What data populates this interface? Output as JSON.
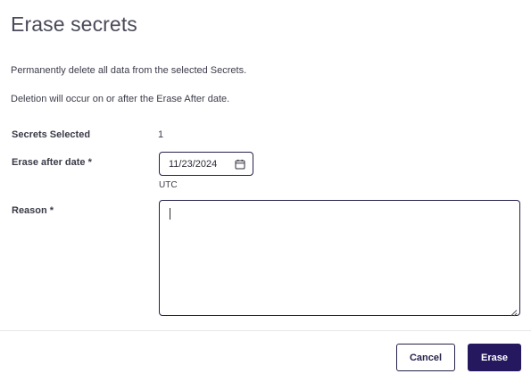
{
  "dialog": {
    "title": "Erase secrets",
    "description_1": "Permanently delete all data from the selected Secrets.",
    "description_2": "Deletion will occur on or after the Erase After date."
  },
  "form": {
    "secrets_selected_label": "Secrets Selected",
    "secrets_selected_value": "1",
    "erase_after_label": "Erase after date *",
    "erase_after_value": "11/23/2024",
    "timezone": "UTC",
    "reason_label": "Reason *",
    "reason_value": ""
  },
  "footer": {
    "cancel_label": "Cancel",
    "erase_label": "Erase"
  },
  "colors": {
    "primary": "#25185f",
    "border": "#25224a",
    "text": "#3a3a48"
  },
  "icons": {
    "date_picker": "calendar-icon",
    "textarea_resize": "resize-grip-icon"
  }
}
